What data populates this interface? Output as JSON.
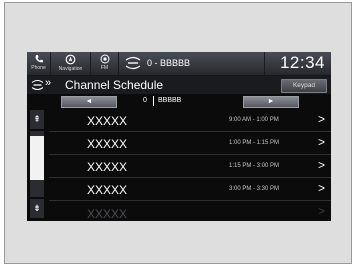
{
  "topbar": {
    "buttons": [
      {
        "label": "Phone",
        "icon": "phone-icon"
      },
      {
        "label": "Navigation",
        "icon": "navigation-icon"
      },
      {
        "label": "FM",
        "icon": "radio-icon"
      }
    ],
    "station": "0 - BBBBB",
    "clock": "12:34"
  },
  "header": {
    "title": "Channel Schedule",
    "keypad_label": "Keypad"
  },
  "channel_nav": {
    "prev_symbol": "◄",
    "next_symbol": "►",
    "channel_number": "0",
    "channel_name": "BBBBB"
  },
  "scroll": {
    "up_symbol": "⇞",
    "down_symbol": "⇟"
  },
  "schedule": [
    {
      "program": "XXXXX",
      "time": "9:00 AM - 1:00 PM"
    },
    {
      "program": "XXXXX",
      "time": "1:00 PM - 1:15 PM"
    },
    {
      "program": "XXXXX",
      "time": "1:15 PM - 3:00 PM"
    },
    {
      "program": "XXXXX",
      "time": "3:00 PM - 3:30 PM"
    },
    {
      "program": "XXXXX",
      "time": ""
    }
  ],
  "colors": {
    "screen_bg": "#0b0b0b",
    "bezel": "#dedede",
    "text": "#ffffff"
  }
}
